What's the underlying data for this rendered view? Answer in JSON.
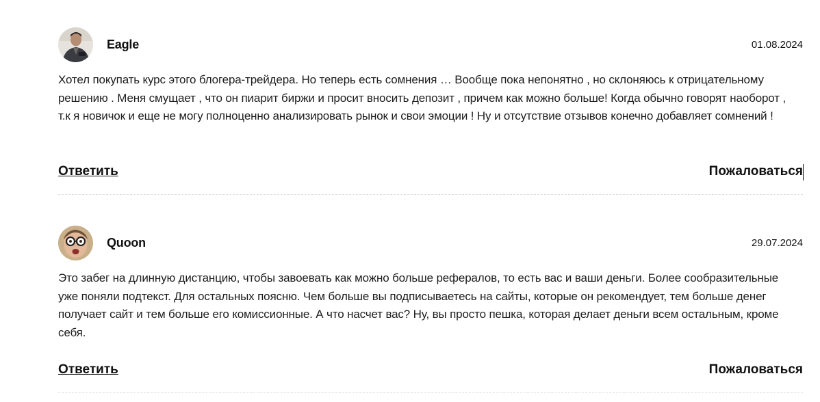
{
  "comments": [
    {
      "author": "Eagle",
      "date": "01.08.2024",
      "avatar_icon": "user-avatar-man-icon",
      "text": "Хотел покупать курс этого блогера-трейдера. Но теперь есть сомнения … Вообще пока непонятно , но склоняюсь к отрицательному решению . Меня смущает , что он пиарит биржи и просит вносить депозит , причем как можно больше! Когда обычно говорят наоборот , т.к я новичок и еще не могу полноценно анализировать рынок и свои эмоции ! Ну и отсутствие отзывов конечно добавляет сомнений !",
      "reply_label": "Ответить",
      "report_label": "Пожаловаться"
    },
    {
      "author": "Quoon",
      "date": "29.07.2024",
      "avatar_icon": "user-avatar-face-icon",
      "text": "Это забег на длинную дистанцию, чтобы завоевать как можно больше рефералов, то есть вас и ваши деньги. Более сообразительные уже поняли подтекст. Для остальных поясню. Чем больше вы подписываетесь на сайты, которые он рекомендует, тем больше денег получает сайт и тем больше его комиссионные. А что насчет вас? Ну, вы просто пешка, которая делает деньги всем остальным, кроме себя.",
      "reply_label": "Ответить",
      "report_label": "Пожаловаться"
    }
  ]
}
